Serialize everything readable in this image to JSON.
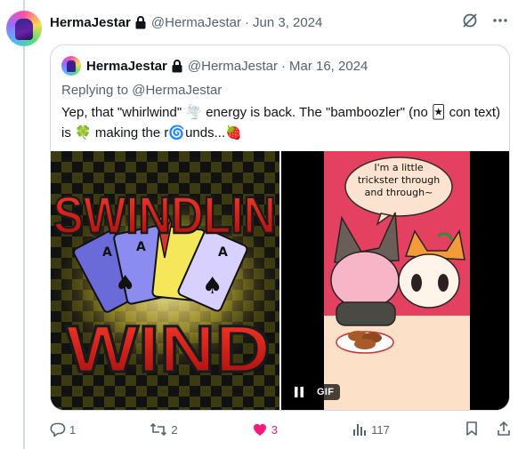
{
  "tweet": {
    "author_name": "HermaJestar",
    "handle": "@HermaJestar",
    "separator": "·",
    "date": "Jun 3, 2024",
    "icons": [
      "lock-icon",
      "grok-icon",
      "more-icon"
    ]
  },
  "quote": {
    "author_name": "HermaJestar",
    "handle": "@HermaJestar",
    "separator": "·",
    "date": "Mar 16, 2024",
    "replying_to": "Replying to @HermaJestar",
    "text": {
      "p1": "Yep, that \"whirlwind\" ",
      "e1": "🌪️",
      "p2": " energy is back. The \"bamboozler\" (no ",
      "e2": "🃏",
      "p3": " con text) is ",
      "e3": "🍀",
      "p4": " making the r",
      "e4": "🌀",
      "p5": "unds...",
      "e5": "🍓"
    },
    "media_left": {
      "logo_top": "SWINDLIN",
      "logo_bottom": "WIND",
      "card_letter": "A"
    },
    "media_right": {
      "speech_bubble": [
        "I'm a little",
        "trickster through",
        "and through~"
      ],
      "gif_badge": "GIF"
    }
  },
  "actions": {
    "replies": "1",
    "reposts": "2",
    "likes": "3",
    "views": "117"
  },
  "colors": {
    "like": "#f91880",
    "muted": "#536471",
    "border": "#cfd9de",
    "comic_pink": "#e3415f",
    "comic_floor": "#fde0c8"
  }
}
